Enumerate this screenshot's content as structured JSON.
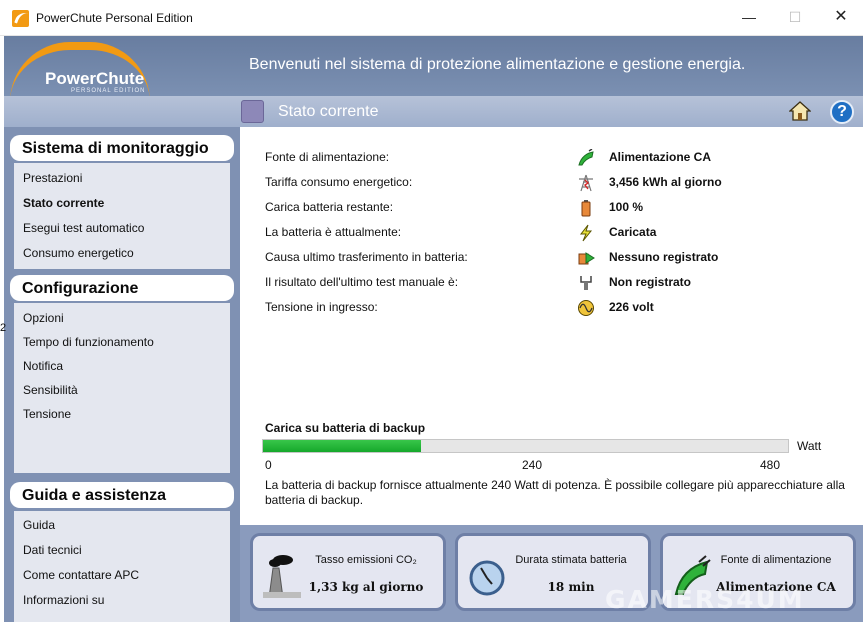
{
  "window": {
    "title": "PowerChute Personal Edition",
    "min": "—",
    "max": "☐",
    "close": "✕"
  },
  "logo": {
    "name": "PowerChute",
    "sub": "PERSONAL EDITION"
  },
  "banner": {
    "message": "Benvenuti nel sistema di protezione alimentazione e gestione energia."
  },
  "subheader": {
    "title": "Stato corrente"
  },
  "sidebar": {
    "sections": [
      {
        "title": "Sistema di monitoraggio",
        "items": [
          {
            "label": "Prestazioni",
            "active": false
          },
          {
            "label": "Stato corrente",
            "active": true
          },
          {
            "label": "Esegui test automatico",
            "active": false
          },
          {
            "label": "Consumo energetico",
            "active": false
          }
        ]
      },
      {
        "title": "Configurazione",
        "items": [
          {
            "label": "Opzioni"
          },
          {
            "label": "Tempo di funzionamento"
          },
          {
            "label": "Notifica"
          },
          {
            "label": "Sensibilità"
          },
          {
            "label": "Tensione"
          }
        ]
      },
      {
        "title": "Guida e assistenza",
        "items": [
          {
            "label": "Guida"
          },
          {
            "label": "Dati tecnici"
          },
          {
            "label": "Come contattare APC"
          },
          {
            "label": "Informazioni su"
          }
        ]
      }
    ],
    "edge_marker": "2"
  },
  "status": {
    "rows": [
      {
        "label": "Fonte di alimentazione:",
        "value": "Alimentazione CA",
        "icon": "plug-icon"
      },
      {
        "label": "Tariffa consumo energetico:",
        "value": "3,456 kWh al giorno",
        "icon": "power-tower-icon"
      },
      {
        "label": "Carica batteria restante:",
        "value": "100 %",
        "icon": "battery-icon"
      },
      {
        "label": "La batteria è attualmente:",
        "value": "Caricata",
        "icon": "lightning-icon"
      },
      {
        "label": "Causa ultimo trasferimento in batteria:",
        "value": "Nessuno registrato",
        "icon": "transfer-icon"
      },
      {
        "label": "Il risultato dell'ultimo test manuale è:",
        "value": "Non registrato",
        "icon": "test-icon"
      },
      {
        "label": "Tensione in ingresso:",
        "value": "226 volt",
        "icon": "voltage-icon"
      }
    ]
  },
  "capacity": {
    "title": "Carica su batteria di backup",
    "unit": "Watt",
    "value": 240,
    "max": 480,
    "fill_fraction": 0.3,
    "ticks": [
      "0",
      "240",
      "480"
    ],
    "description": "La batteria di backup fornisce attualmente 240 Watt di potenza. È possibile collegare più apparecchiature alla batteria di backup."
  },
  "cards": [
    {
      "title": "Tasso emissioni CO₂",
      "value": "1,33 kg al giorno",
      "icon": "factory-icon"
    },
    {
      "title": "Durata stimata batteria",
      "value": "18 min",
      "icon": "clock-icon"
    },
    {
      "title": "Fonte di alimentazione",
      "value": "Alimentazione CA",
      "icon": "plug-icon"
    }
  ],
  "watermark": "GAMERS4UM",
  "colors": {
    "accent_orange": "#f29a13",
    "banner": "#6f84a7",
    "bar_green": "#1fb232"
  }
}
